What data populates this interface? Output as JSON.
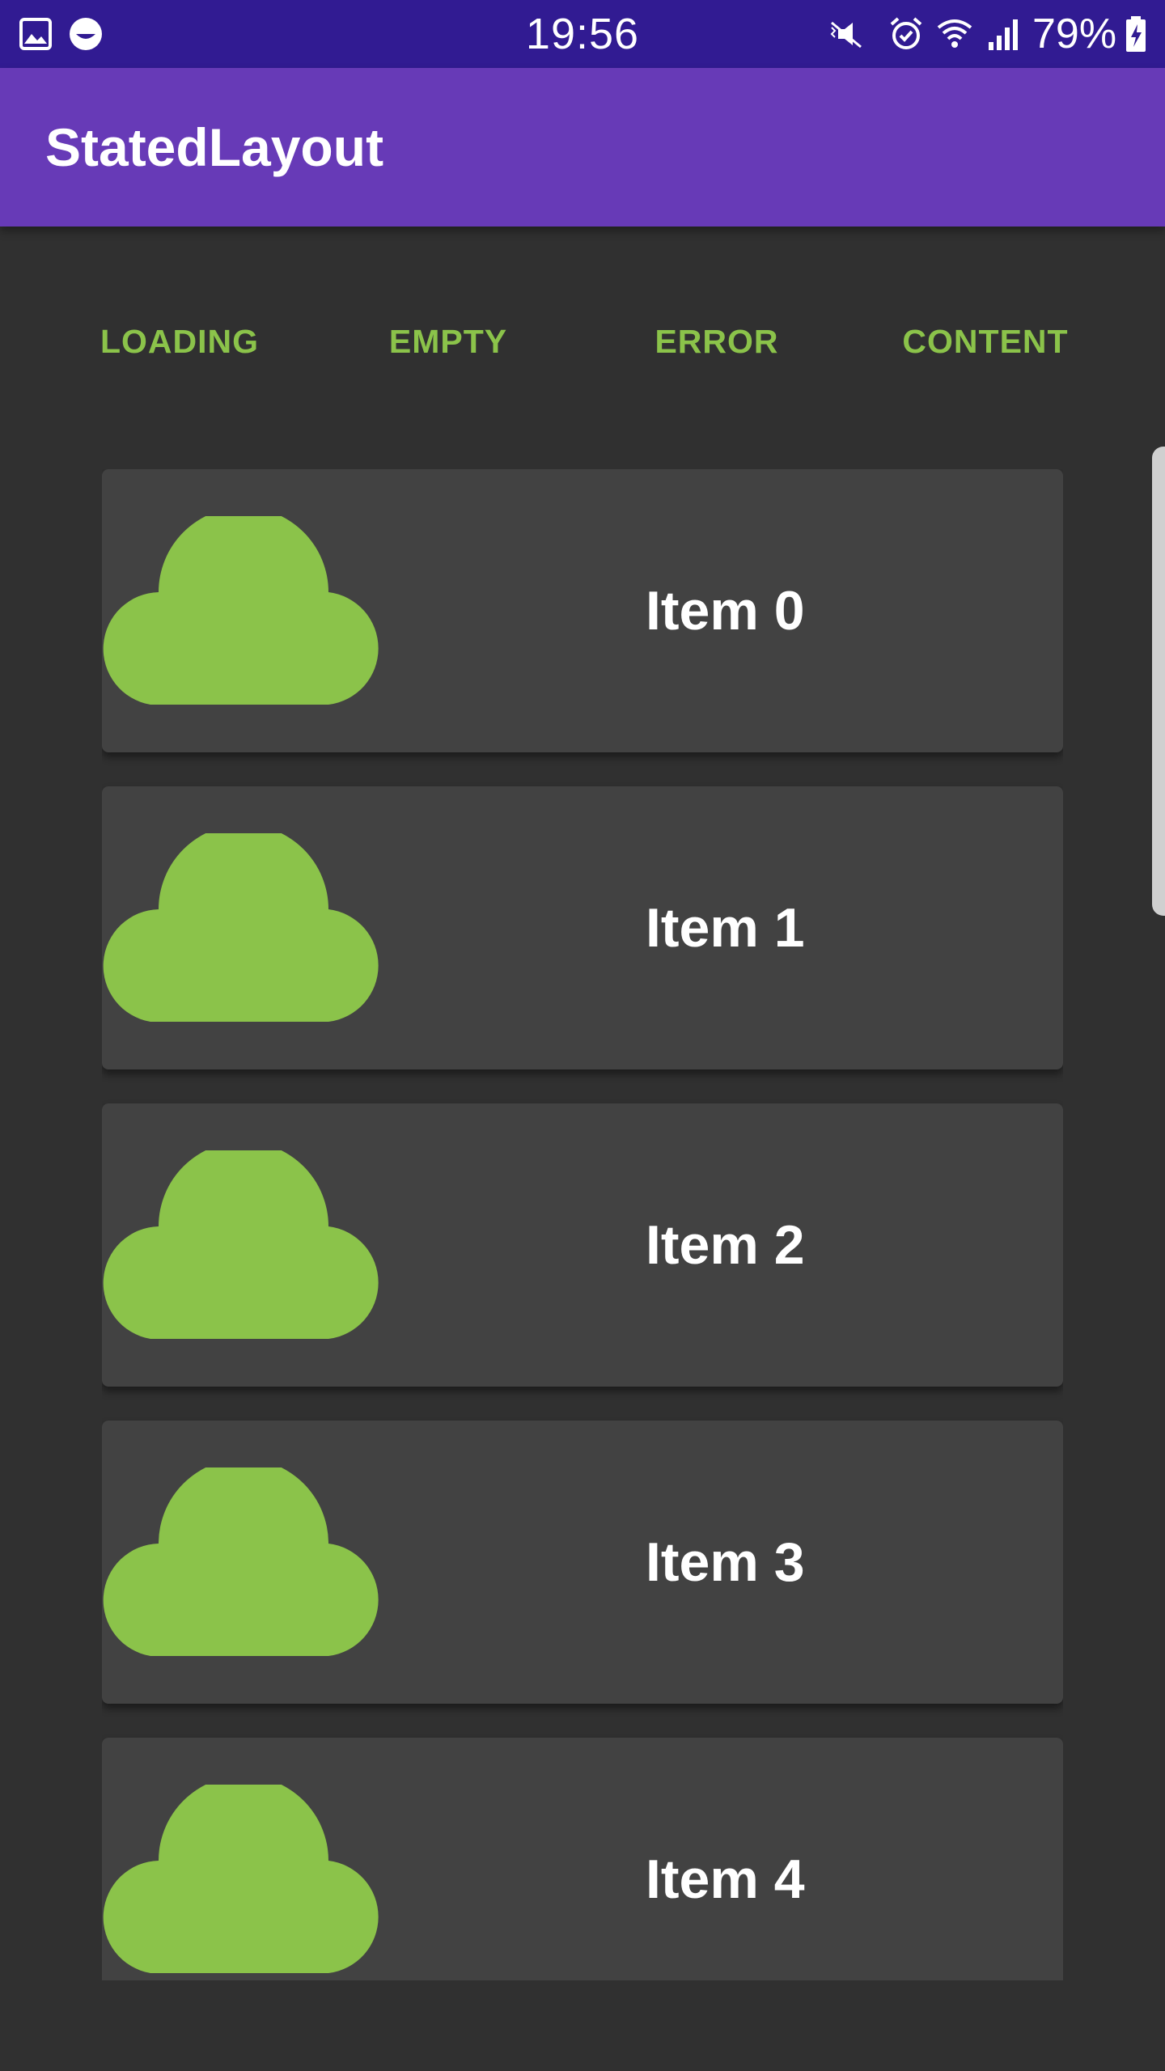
{
  "status_bar": {
    "time": "19:56",
    "battery": "79%",
    "icons": [
      "gallery-icon",
      "emoji-icon",
      "mute-icon",
      "alarm-icon",
      "wifi-icon",
      "signal-icon",
      "battery-charging-icon"
    ]
  },
  "app_bar": {
    "title": "StatedLayout",
    "color": "#673ab7"
  },
  "state_buttons": [
    {
      "label": "LOADING"
    },
    {
      "label": "EMPTY"
    },
    {
      "label": "ERROR"
    },
    {
      "label": "CONTENT"
    }
  ],
  "list": {
    "items": [
      {
        "label": "Item 0",
        "icon": "cloud-icon"
      },
      {
        "label": "Item 1",
        "icon": "cloud-icon"
      },
      {
        "label": "Item 2",
        "icon": "cloud-icon"
      },
      {
        "label": "Item 3",
        "icon": "cloud-icon"
      },
      {
        "label": "Item 4",
        "icon": "cloud-icon"
      }
    ]
  },
  "colors": {
    "accent": "#8bc34a",
    "background": "#303030",
    "card": "#424242",
    "status_bar": "#311b92"
  }
}
